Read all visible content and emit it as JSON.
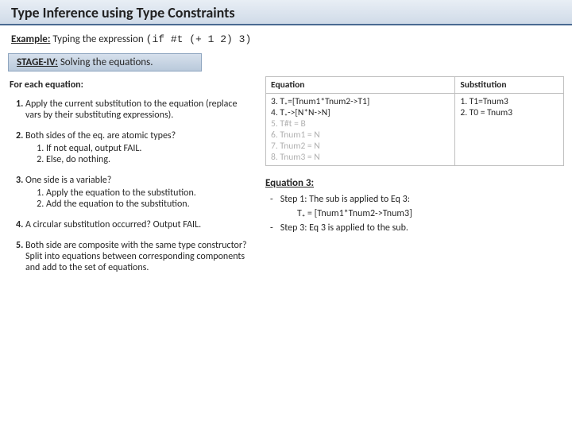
{
  "title": "Type Inference using Type Constraints",
  "example": {
    "label": "Example:",
    "intro": "Typing the expression",
    "code": "(if #t (+ 1 2) 3)"
  },
  "stage": {
    "prefix": "STAGE-IV:",
    "text": "Solving the equations."
  },
  "forEach": "For each equation:",
  "steps": {
    "s1": "Apply the current substitution to the equation (replace vars by their substituting expressions).",
    "s2": "Both sides of the eq. are atomic types?",
    "s2a": "If not equal, output FAIL.",
    "s2b": "Else, do nothing.",
    "s3": "One side is a variable?",
    "s3a": "Apply the equation to the substitution.",
    "s3b": "Add the equation to the substitution.",
    "s4": "A circular substitution occurred? Output FAIL.",
    "s5": "Both side are composite with the same type constructor? Split into equations between corresponding components and add to the set of equations."
  },
  "table": {
    "hEq": "Equation",
    "hSub": "Substitution",
    "eq3": "3. T₊=[Tnum1*Tnum2->T1]",
    "eq4": "4. T₊->[N*N->N]",
    "eq5": "5. T#t = B",
    "eq6": "6. Tnum1 = N",
    "eq7": "7. Tnum2 = N",
    "eq8": "8. Tnum3 = N",
    "sub1": "1. T1=Tnum3",
    "sub2": "2. T0 = Tnum3"
  },
  "detail": {
    "heading": "Equation 3:",
    "line1pre": "Step 1: The sub is applied to Eq 3:",
    "line1eq": "T₊ = [Tnum1*Tnum2->Tnum3]",
    "line2": "Step 3: Eq 3 is applied to the sub."
  }
}
